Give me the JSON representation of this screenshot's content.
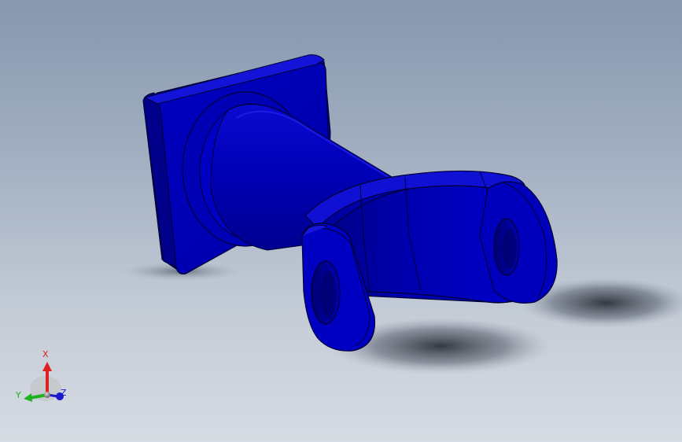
{
  "viewport": {
    "background_top": "#8797ad",
    "background_bottom": "#d6dce3"
  },
  "model": {
    "part_color": "#0000c8",
    "part_color_dark": "#00007a",
    "part_color_light": "#1a1ae6",
    "edge_color": "#000033"
  },
  "triad": {
    "x_label": "X",
    "y_label": "Y",
    "z_label": "Z",
    "x_color": "#e02020",
    "y_color": "#1fb31f",
    "z_color": "#1a1acc"
  }
}
